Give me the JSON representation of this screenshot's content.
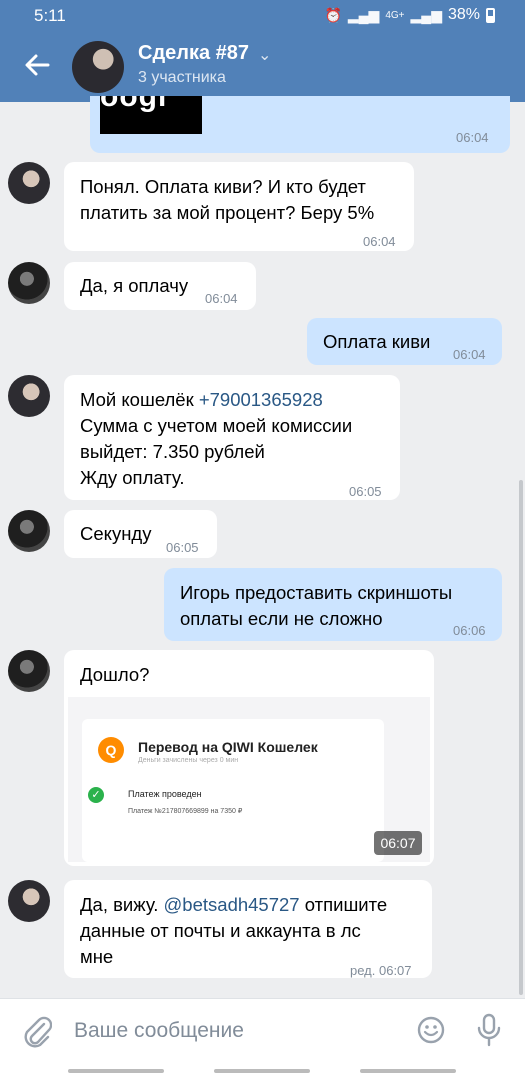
{
  "status_bar": {
    "time": "5:11",
    "network": "4G+",
    "battery": "38%"
  },
  "header": {
    "title": "Сделка #87",
    "subtitle": "3 участника"
  },
  "messages": [
    {
      "time": "06:04"
    },
    {
      "text_lines": [
        "Понял. Оплата киви? И кто будет",
        "платить за мой процент? Беру 5%"
      ],
      "time": "06:04"
    },
    {
      "text": "Да, я оплачу",
      "time": "06:04"
    },
    {
      "text": "Оплата киви",
      "time": "06:04"
    },
    {
      "line1_prefix": "Мой кошелёк ",
      "line1_link": "+79001365928",
      "lines": [
        "Сумма с учетом моей комиссии",
        "выйдет: 7.350 рублей",
        "Жду оплату."
      ],
      "time": "06:05"
    },
    {
      "text": "Секунду",
      "time": "06:05"
    },
    {
      "text_lines": [
        "Игорь предоставить скриншоты",
        "оплаты если не сложно"
      ],
      "time": "06:06"
    },
    {
      "text": "Дошло?",
      "image_time": "06:07",
      "qiwi": {
        "logo_letter": "Q",
        "title": "Перевод на QIWI Кошелек",
        "subtitle": "Деньги зачислены через 0 мин",
        "status": "Платеж проведен",
        "detail": "Платеж №217807669899 на 7350 ₽"
      }
    },
    {
      "line1_prefix": "Да, вижу. ",
      "line1_link": "@betsadh45727",
      "line1_suffix": " отпишите",
      "lines": [
        "данные от почты и аккаунта в лс",
        "мне"
      ],
      "time": "ред. 06:07"
    }
  ],
  "composer": {
    "placeholder": "Ваше сообщение"
  }
}
